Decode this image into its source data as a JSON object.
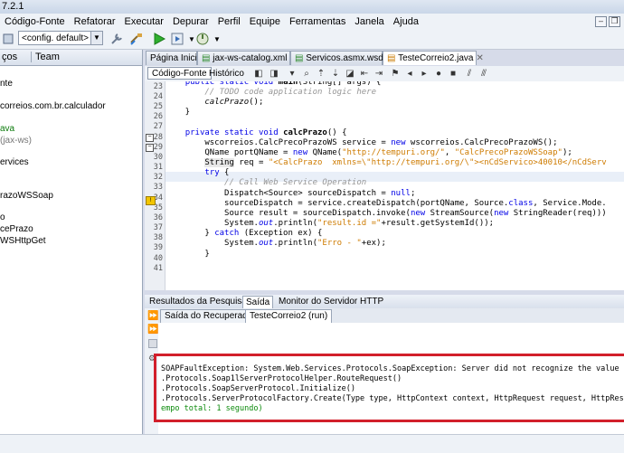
{
  "window": {
    "title": "7.2.1"
  },
  "menu": [
    "Código-Fonte",
    "Refatorar",
    "Executar",
    "Depurar",
    "Perfil",
    "Equipe",
    "Ferramentas",
    "Janela",
    "Ajuda"
  ],
  "toolbar": {
    "config": "<config. default>"
  },
  "left_panel": {
    "tabs": [
      "ços",
      "Team"
    ],
    "items": [
      "nte",
      "correios.com.br.calculador",
      "ava",
      "(jax-ws)",
      "ervices",
      "razoWSSoap",
      "o",
      "cePrazo",
      "WSHttpGet"
    ]
  },
  "editor": {
    "tabs": [
      {
        "label": "Página Inicial"
      },
      {
        "label": "jax-ws-catalog.xml"
      },
      {
        "label": "Servicos.asmx.wsdl"
      },
      {
        "label": "TesteCorreio2.java"
      }
    ],
    "source_button": "Código-Fonte",
    "history_button": "Histórico",
    "line_numbers": [
      "23",
      "24",
      "25",
      "26",
      "27",
      "28",
      "29",
      "30",
      "31",
      "32",
      "33",
      "34",
      "35",
      "36",
      "37",
      "38",
      "39",
      "40",
      "41"
    ]
  },
  "output": {
    "tabs": [
      "Resultados da Pesquisa",
      "Saída",
      "Monitor do Servidor HTTP"
    ],
    "subtabs": [
      "Saída do Recuperador",
      "TesteCorreio2 (run)"
    ],
    "lines": [
      "SOAPFaultException: System.Web.Services.Protocols.SoapException: Server did not recognize the value of HTT",
      ".Protocols.Soap1lServerProtocolHelper.RouteRequest()",
      ".Protocols.SoapServerProtocol.Initialize()",
      ".Protocols.ServerProtocolFactory.Create(Type type, HttpContext context, HttpRequest request, HttpResponse",
      "empo total: 1 segundo)"
    ]
  }
}
